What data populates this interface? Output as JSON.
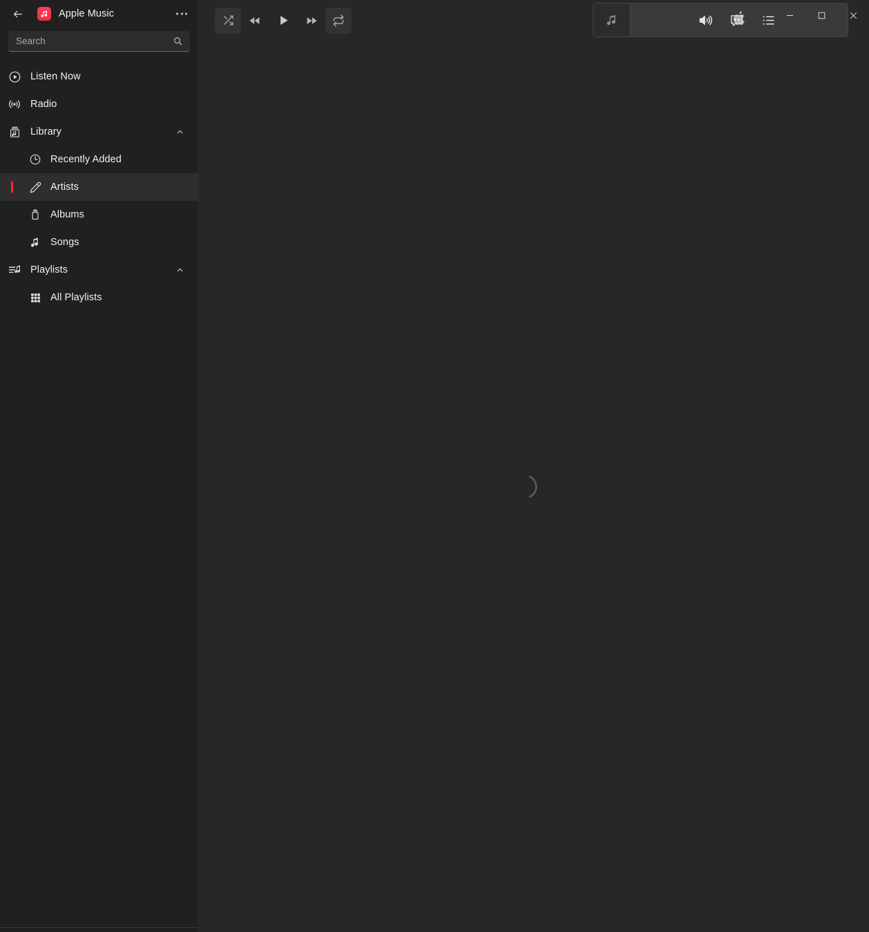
{
  "window": {
    "title": "Apple Music",
    "back_label": "Back",
    "more_label": "See more",
    "minimize_label": "Minimize",
    "maximize_label": "Maximize",
    "close_label": "Close",
    "logo_icon": "apple-music-logo-icon"
  },
  "search": {
    "placeholder": "Search",
    "value": "",
    "icon": "search-icon"
  },
  "sidebar": {
    "items": [
      {
        "label": "Listen Now",
        "icon": "play-circle-icon",
        "level": "top",
        "selected": false,
        "expandable": false
      },
      {
        "label": "Radio",
        "icon": "broadcast-icon",
        "level": "top",
        "selected": false,
        "expandable": false
      },
      {
        "label": "Library",
        "icon": "library-icon",
        "level": "top",
        "selected": false,
        "expandable": true,
        "expanded": true
      },
      {
        "label": "Recently Added",
        "icon": "clock-icon",
        "level": "child",
        "selected": false,
        "expandable": false
      },
      {
        "label": "Artists",
        "icon": "microphone-icon",
        "level": "child",
        "selected": true,
        "expandable": false
      },
      {
        "label": "Albums",
        "icon": "album-icon",
        "level": "child",
        "selected": false,
        "expandable": false
      },
      {
        "label": "Songs",
        "icon": "music-note-icon",
        "level": "child",
        "selected": false,
        "expandable": false
      },
      {
        "label": "Playlists",
        "icon": "playlist-icon",
        "level": "top",
        "selected": false,
        "expandable": true,
        "expanded": true
      },
      {
        "label": "All Playlists",
        "icon": "grid-icon",
        "level": "child",
        "selected": false,
        "expandable": false
      }
    ]
  },
  "player": {
    "shuffle_label": "Shuffle",
    "previous_label": "Previous",
    "play_label": "Play",
    "next_label": "Next",
    "repeat_label": "Repeat",
    "volume_label": "Volume",
    "lyrics_label": "Lyrics",
    "queue_label": "Playing Next",
    "nowplaying": {
      "artwork_icon": "music-note-icon",
      "display_icon": "apple-logo-icon",
      "title": "",
      "subtitle": ""
    }
  },
  "main": {
    "state": "loading",
    "spinner_label": "Loading"
  },
  "colors": {
    "accent": "#fa253f",
    "logo": "#f52d44",
    "sidebar_bg": "#202020",
    "main_bg": "#272727",
    "selected_row": "#2e2e2e",
    "text": "#f0f0f0"
  }
}
